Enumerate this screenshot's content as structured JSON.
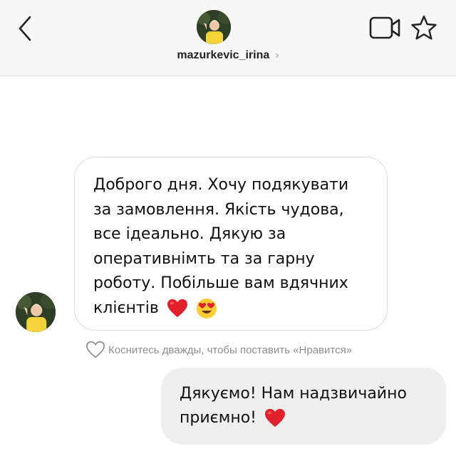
{
  "header": {
    "username": "mazurkevic_irina",
    "username_chevron": "›",
    "icons": [
      "back-icon",
      "avatar",
      "video-call-icon",
      "star-icon"
    ]
  },
  "messages": {
    "incoming": {
      "lines": [
        "Доброго дня.  Хочу подякувати",
        "за замовлення.  Якість чудова,",
        "все ідеально.  Дякую за",
        "оперативнімть та за гарну",
        "роботу.  Побільше вам вдячних",
        "клієнтів"
      ],
      "trailing_emojis": [
        "red-heart-icon",
        "heart-eyes-icon"
      ]
    },
    "like_hint": "Коснитесь дважды, чтобы поставить «Нравится»",
    "outgoing": {
      "lines": [
        "Дякуємо! Нам надзвичайно",
        "приємно!"
      ],
      "trailing_emojis": [
        "red-heart-icon"
      ]
    }
  },
  "colors": {
    "header_bg": "#f7f7f7",
    "outgoing_bubble_bg": "#efefef",
    "incoming_bubble_border": "#dcdcdc",
    "hint_text": "#8e8e8e",
    "heart": "#e0202a",
    "avatar_shirt": "#f2d33a"
  }
}
